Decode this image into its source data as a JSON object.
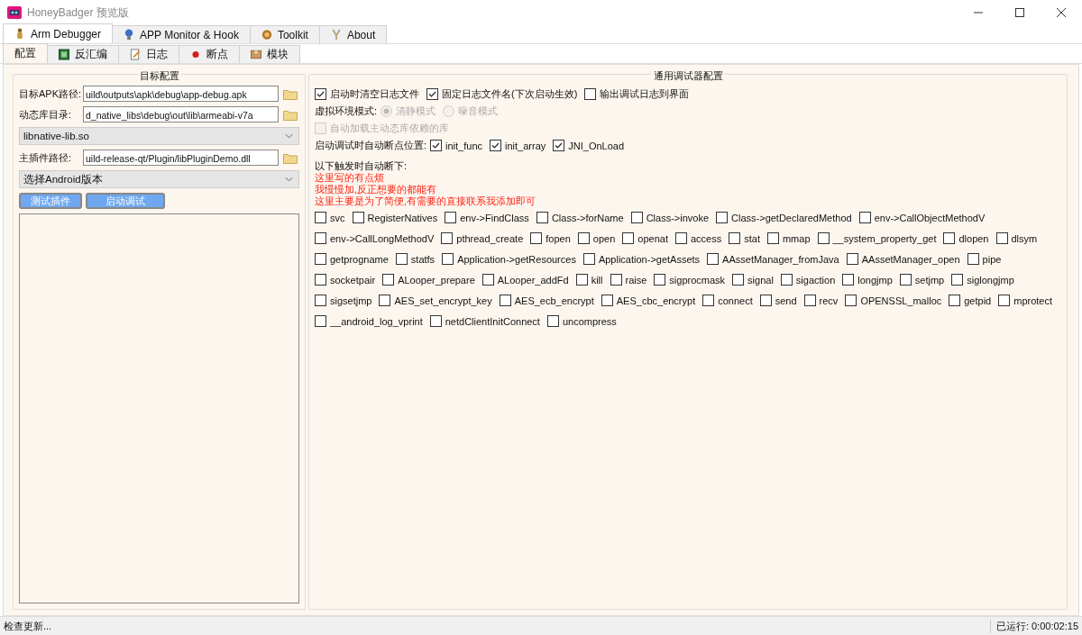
{
  "window": {
    "title": "HoneyBadger 预览版"
  },
  "main_tabs": [
    {
      "label": "Arm Debugger",
      "selected": true
    },
    {
      "label": "APP Monitor & Hook",
      "selected": false
    },
    {
      "label": "Toolkit",
      "selected": false
    },
    {
      "label": "About",
      "selected": false
    }
  ],
  "sub_tabs": [
    {
      "label": "配置",
      "selected": true
    },
    {
      "label": "反汇编",
      "selected": false
    },
    {
      "label": "日志",
      "selected": false
    },
    {
      "label": "断点",
      "selected": false
    },
    {
      "label": "模块",
      "selected": false
    }
  ],
  "target_config": {
    "title": "目标配置",
    "path_fields": [
      {
        "label": "目标APK路径:",
        "value": "uild\\outputs\\apk\\debug\\app-debug.apk"
      },
      {
        "label": "动态库目录:",
        "value": "d_native_libs\\debug\\out\\lib\\armeabi-v7a"
      }
    ],
    "lib_select": "libnative-lib.so",
    "plugin_field": {
      "label": "主插件路径:",
      "value": "uild-release-qt/Plugin/libPluginDemo.dll"
    },
    "android_select": "选择Android版本",
    "buttons": [
      "测试插件",
      "启动调试"
    ]
  },
  "debugger_config": {
    "title": "通用调试器配置",
    "options": [
      {
        "label": "启动时清空日志文件",
        "checked": true
      },
      {
        "label": "固定日志文件名(下次启动生效)",
        "checked": true
      },
      {
        "label": "输出调试日志到界面",
        "checked": false
      }
    ],
    "env_mode": {
      "label": "虚拟环境模式:",
      "disabled": true,
      "options": [
        {
          "label": "清静模式",
          "selected": true
        },
        {
          "label": "噪音模式",
          "selected": false
        }
      ]
    },
    "auto_load": {
      "label": "自动加载主动态库依赖的库",
      "checked": false,
      "disabled": true
    },
    "breakpoints": {
      "label": "启动调试时自动断点位置:",
      "items": [
        {
          "label": "init_func",
          "checked": true
        },
        {
          "label": "init_array",
          "checked": true
        },
        {
          "label": "JNI_OnLoad",
          "checked": true
        }
      ]
    },
    "trigger_label": "以下触发时自动断下:",
    "notes": [
      "这里写的有点烦",
      "我慢慢加,反正想要的都能有",
      "这里主要是为了简便,有需要的直接联系我添加即可"
    ],
    "hook_rows": [
      [
        {
          "label": "svc",
          "checked": false
        },
        {
          "label": "RegisterNatives",
          "checked": false
        },
        {
          "label": "env->FindClass",
          "checked": false
        },
        {
          "label": "Class->forName",
          "checked": false
        },
        {
          "label": "Class->invoke",
          "checked": false
        },
        {
          "label": "Class->getDeclaredMethod",
          "checked": false
        },
        {
          "label": "env->CallObjectMethodV",
          "checked": false
        }
      ],
      [
        {
          "label": "env->CallLongMethodV",
          "checked": false
        },
        {
          "label": "pthread_create",
          "checked": false
        },
        {
          "label": "fopen",
          "checked": false
        },
        {
          "label": "open",
          "checked": false
        },
        {
          "label": "openat",
          "checked": false
        },
        {
          "label": "access",
          "checked": false
        },
        {
          "label": "stat",
          "checked": false
        },
        {
          "label": "mmap",
          "checked": false
        },
        {
          "label": "__system_property_get",
          "checked": false
        },
        {
          "label": "dlopen",
          "checked": false
        },
        {
          "label": "dlsym",
          "checked": false
        }
      ],
      [
        {
          "label": "getprogname",
          "checked": false
        },
        {
          "label": "statfs",
          "checked": false
        },
        {
          "label": "Application->getResources",
          "checked": false
        },
        {
          "label": "Application->getAssets",
          "checked": false
        },
        {
          "label": "AAssetManager_fromJava",
          "checked": false
        },
        {
          "label": "AAssetManager_open",
          "checked": false
        },
        {
          "label": "pipe",
          "checked": false
        }
      ],
      [
        {
          "label": "socketpair",
          "checked": false
        },
        {
          "label": "ALooper_prepare",
          "checked": false
        },
        {
          "label": "ALooper_addFd",
          "checked": false
        },
        {
          "label": "kill",
          "checked": false
        },
        {
          "label": "raise",
          "checked": false
        },
        {
          "label": "sigprocmask",
          "checked": false
        },
        {
          "label": "signal",
          "checked": false
        },
        {
          "label": "sigaction",
          "checked": false
        },
        {
          "label": "longjmp",
          "checked": false
        },
        {
          "label": "setjmp",
          "checked": false
        },
        {
          "label": "siglongjmp",
          "checked": false
        }
      ],
      [
        {
          "label": "sigsetjmp",
          "checked": false
        },
        {
          "label": "AES_set_encrypt_key",
          "checked": false
        },
        {
          "label": "AES_ecb_encrypt",
          "checked": false
        },
        {
          "label": "AES_cbc_encrypt",
          "checked": false
        },
        {
          "label": "connect",
          "checked": false
        },
        {
          "label": "send",
          "checked": false
        },
        {
          "label": "recv",
          "checked": false
        },
        {
          "label": "OPENSSL_malloc",
          "checked": false
        },
        {
          "label": "getpid",
          "checked": false
        },
        {
          "label": "mprotect",
          "checked": false
        }
      ],
      [
        {
          "label": "__android_log_vprint",
          "checked": false
        },
        {
          "label": "netdClientInitConnect",
          "checked": false
        },
        {
          "label": "uncompress",
          "checked": false
        }
      ]
    ]
  },
  "status_bar": {
    "message": "检查更新...",
    "runtime": "已运行: 0:00:02:15"
  }
}
